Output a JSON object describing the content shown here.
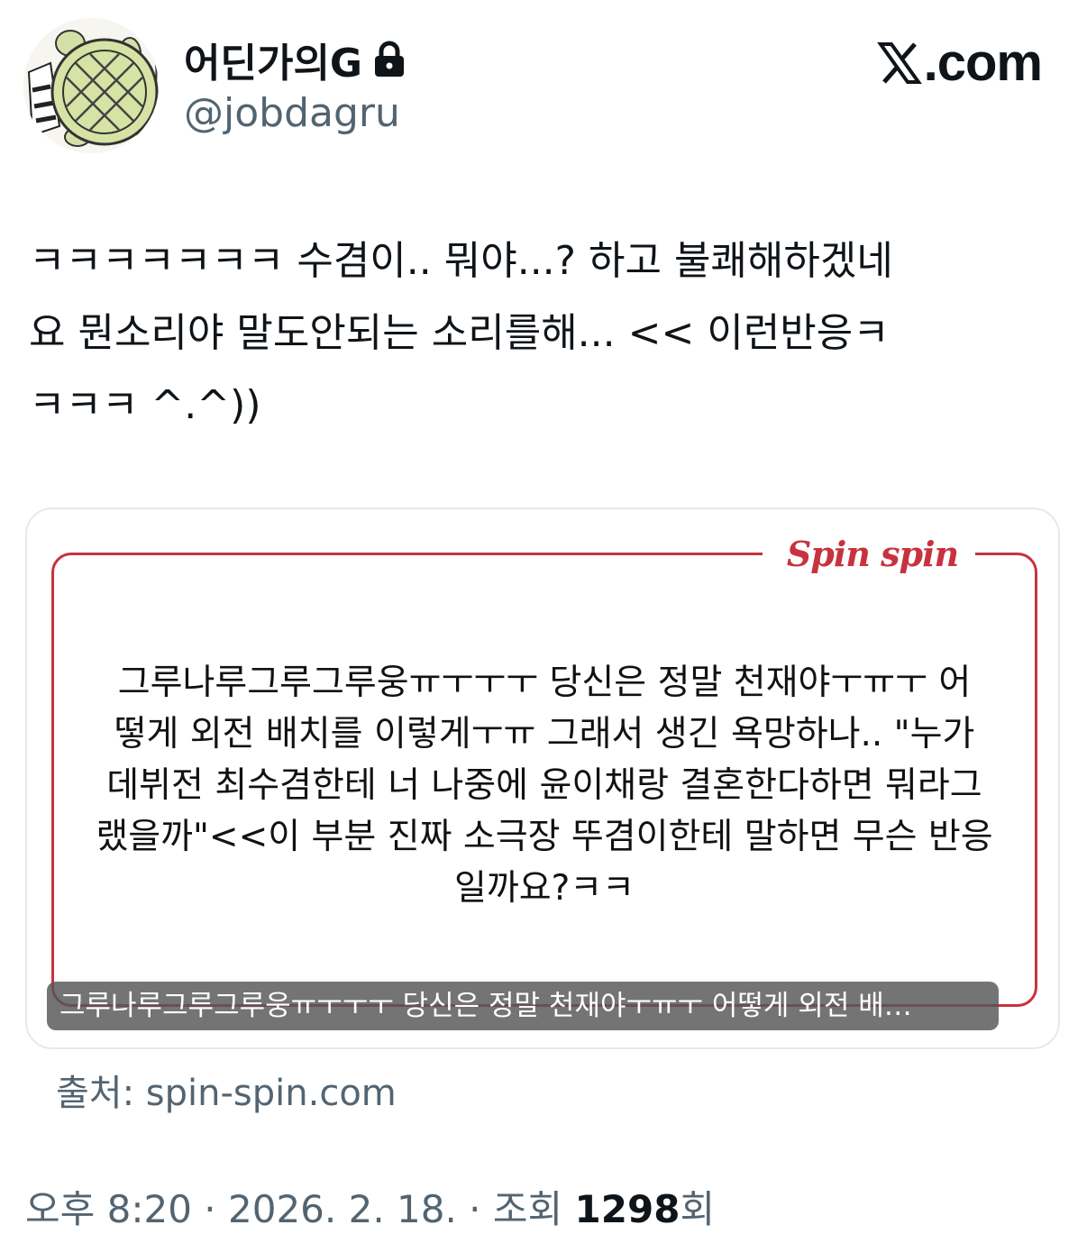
{
  "author": {
    "display_name": "어딘가의G",
    "handle": "@jobdagru",
    "avatar_icon": "turtle-avatar",
    "lock_icon": "lock-icon"
  },
  "brand": {
    "label": ".com",
    "icon": "x-logo-icon"
  },
  "tweet": {
    "lines": [
      "ㅋㅋㅋㅋㅋㅋㅋ 수겸이.. 뭐야...? 하고 불쾌해하겠네",
      "요 뭔소리야 말도안되는 소리를해... << 이런반응ㅋ",
      "ㅋㅋㅋ ^.^))"
    ]
  },
  "card": {
    "site_brand": "Spin spin",
    "frame_color": "#c8323e",
    "body_lines": [
      "그루나루그루그루웅ㅠㅜㅜㅜ 당신은 정말 천재야ㅜㅠㅜ 어",
      "떻게 외전 배치를 이렇게ㅜㅠ 그래서 생긴 욕망하나.. \"누가",
      "데뷔전 최수겸한테 너 나중에 윤이채랑 결혼한다하면 뭐라그",
      "랬을까\"<<이 부분 진짜 소극장 뚜겸이한테 말하면 무슨 반응",
      "일까요?ㅋㅋ"
    ],
    "caption": "그루나루그루그루웅ㅠㅜㅜㅜ 당신은 정말 천재야ㅜㅠㅜ 어떻게 외전 배…"
  },
  "source": "출처: spin-spin.com",
  "meta": {
    "time": "오후 8:20",
    "sep1": " · ",
    "date": "2026. 2. 18.",
    "sep2": " · ",
    "views_label": "조회 ",
    "views_count": "1298",
    "views_suffix": "회"
  }
}
